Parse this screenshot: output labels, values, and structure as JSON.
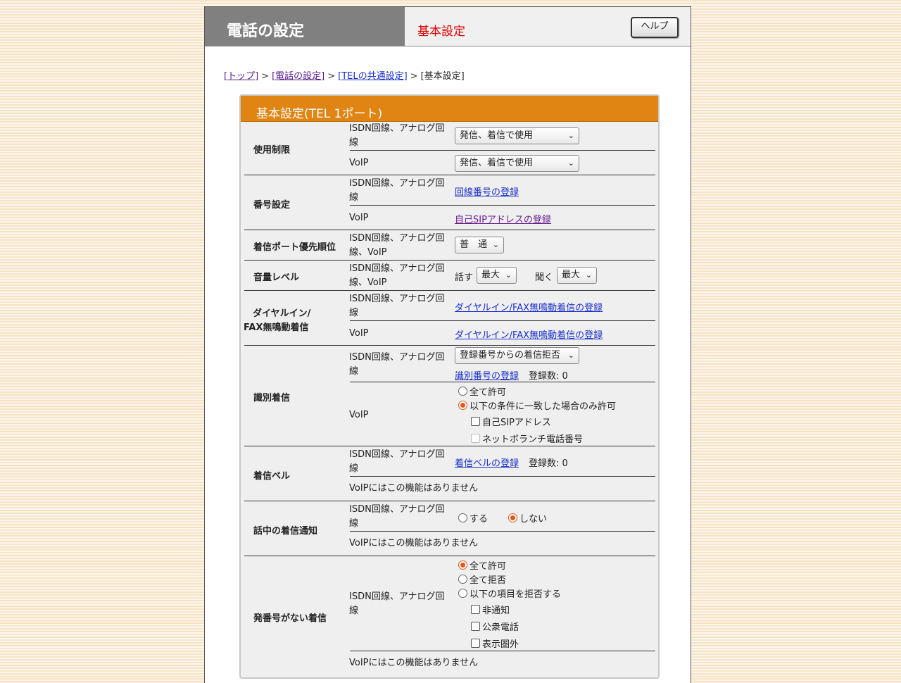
{
  "header": {
    "title": "電話の設定",
    "subtitle": "基本設定",
    "help_label": "ヘルプ"
  },
  "breadcrumb": {
    "top": "[トップ]",
    "phone": "[電話の設定]",
    "tel_common": "[TELの共通設定]",
    "current": "[基本設定]",
    "sep": ">"
  },
  "panel": {
    "title": "基本設定(TEL 1ポート)"
  },
  "line_isdn": "ISDN回線、アナログ回線",
  "line_isdn_voip": "ISDN回線、アナログ回線、VoIP",
  "voip": "VoIP",
  "no_func": "VoIPにはこの機能はありません",
  "sections": {
    "usage": {
      "label": "使用制限",
      "isdn_select": "発信、着信で使用",
      "voip_select": "発信、着信で使用"
    },
    "number": {
      "label": "番号設定",
      "isdn_link": "回線番号の登録",
      "voip_link": "自己SIPアドレスの登録"
    },
    "priority": {
      "label": "着信ポート優先順位",
      "select": "普　通"
    },
    "volume": {
      "label": "音量レベル",
      "speak_label": "話す",
      "speak_select": "最大",
      "listen_label": "聞く",
      "listen_select": "最大"
    },
    "dialin": {
      "label1": "ダイヤルイン/",
      "label2": "FAX無鳴動着信",
      "isdn_link": "ダイヤルイン/FAX無鳴動着信の登録",
      "voip_link": "ダイヤルイン/FAX無鳴動着信の登録"
    },
    "ident": {
      "label": "識別着信",
      "isdn_select": "登録番号からの着信拒否",
      "isdn_link": "識別番号の登録",
      "isdn_count": "登録数: 0",
      "voip_opt_all": "全て許可",
      "voip_opt_cond": "以下の条件に一致した場合のみ許可",
      "voip_chk_sip": "自己SIPアドレス",
      "voip_chk_branch": "ネットボランチ電話番号"
    },
    "bell": {
      "label": "着信ベル",
      "isdn_link": "着信ベルの登録",
      "isdn_count": "登録数: 0"
    },
    "busy": {
      "label": "話中の着信通知",
      "opt_yes": "する",
      "opt_no": "しない"
    },
    "nocaller": {
      "label": "発番号がない着信",
      "opt_allow": "全て許可",
      "opt_reject": "全て拒否",
      "opt_items": "以下の項目を拒否する",
      "chk_private": "非通知",
      "chk_public": "公衆電話",
      "chk_out": "表示圏外"
    }
  }
}
